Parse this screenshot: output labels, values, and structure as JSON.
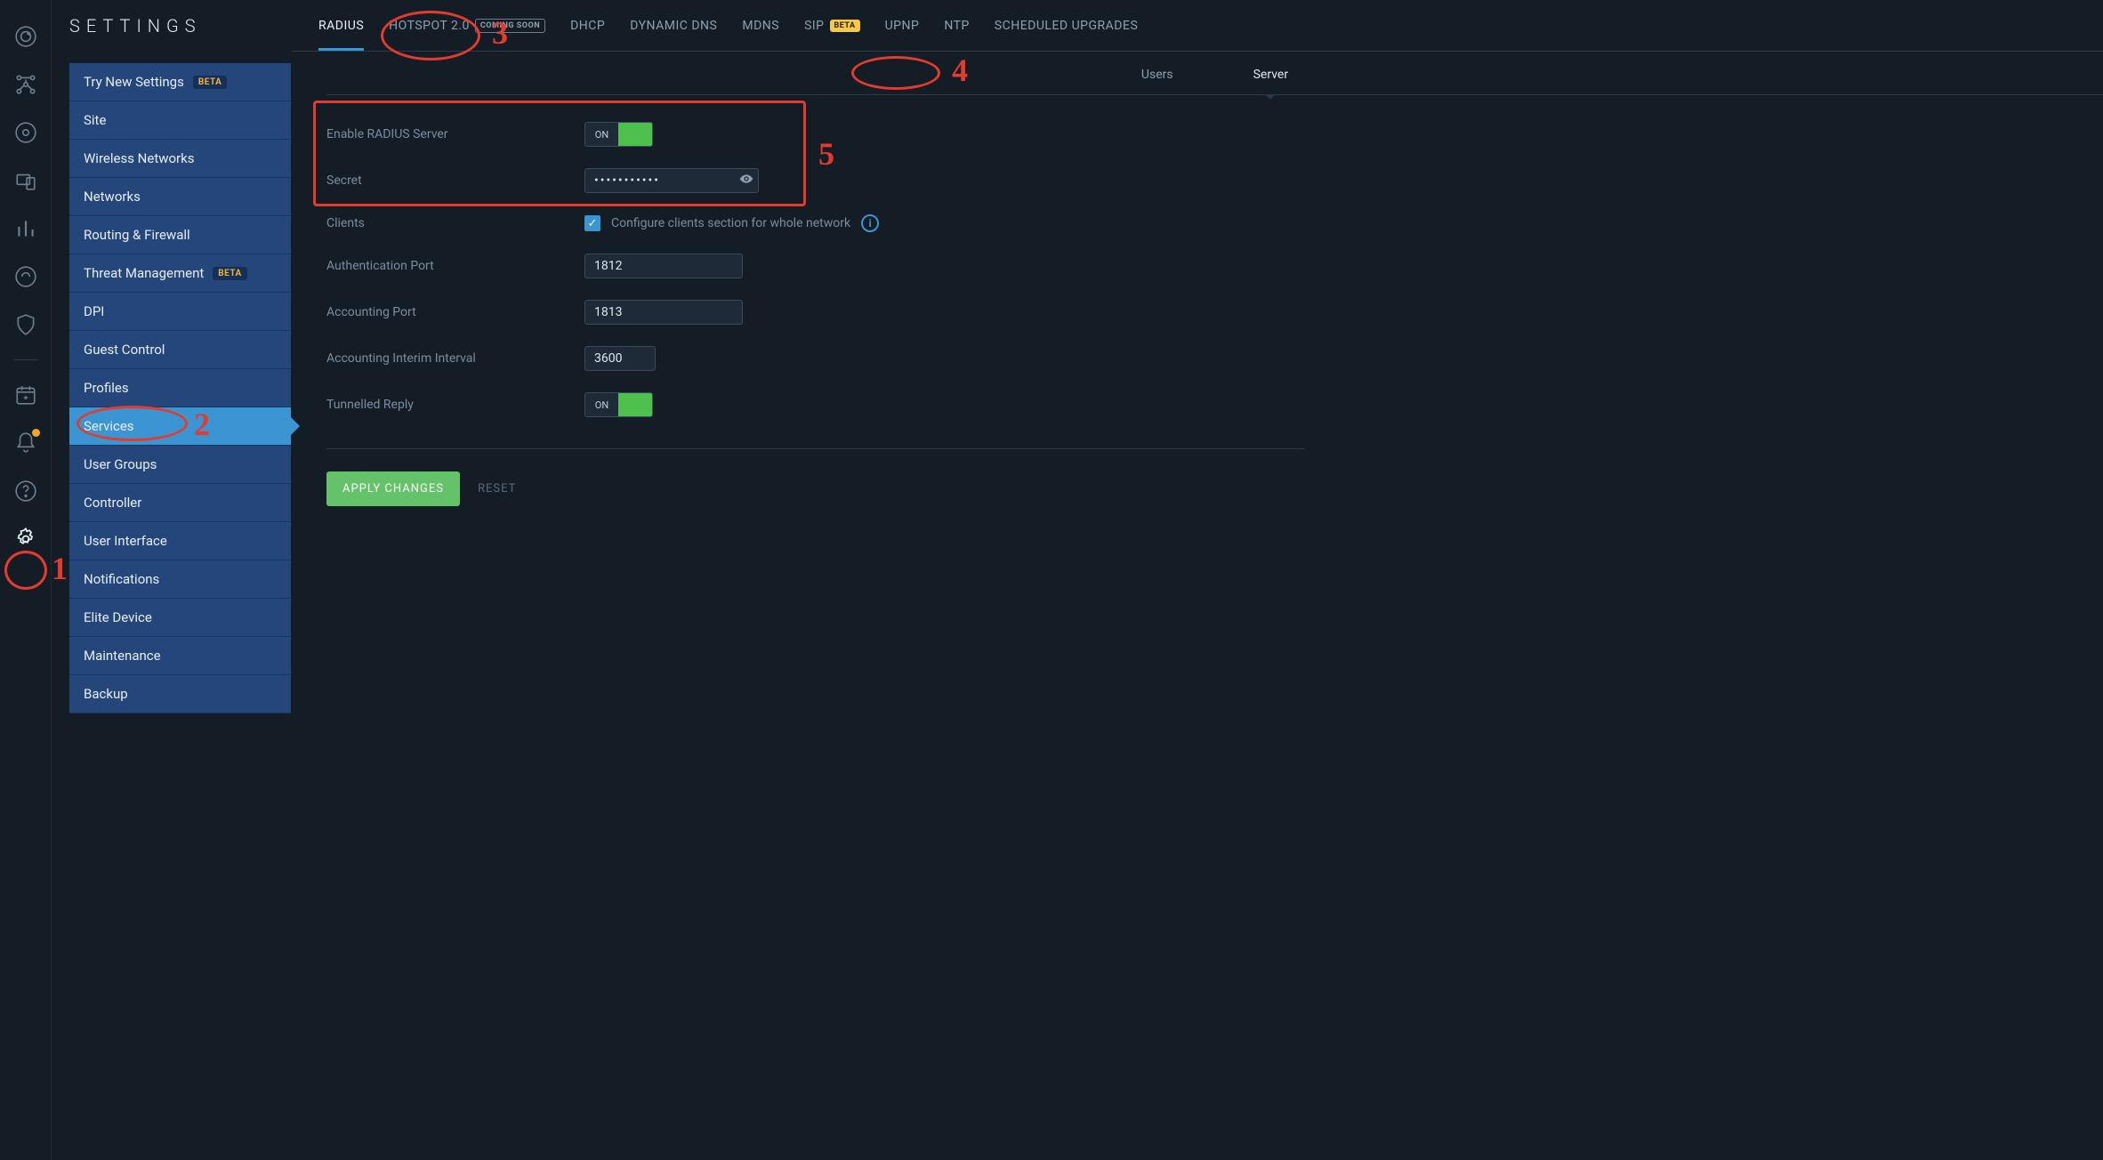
{
  "page_title": "SETTINGS",
  "top_tabs": {
    "radius": "RADIUS",
    "hotspot": "HOTSPOT 2.0",
    "hotspot_badge": "COMING SOON",
    "dhcp": "DHCP",
    "dyndns": "DYNAMIC DNS",
    "mdns": "MDNS",
    "sip": "SIP",
    "sip_badge": "BETA",
    "upnp": "UPNP",
    "ntp": "NTP",
    "sched": "SCHEDULED UPGRADES"
  },
  "subtabs": {
    "users": "Users",
    "server": "Server"
  },
  "sidebar": {
    "try_new": "Try New Settings",
    "try_new_badge": "BETA",
    "site": "Site",
    "wireless": "Wireless Networks",
    "networks": "Networks",
    "routing": "Routing & Firewall",
    "threat": "Threat Management",
    "threat_badge": "BETA",
    "dpi": "DPI",
    "guest": "Guest Control",
    "profiles": "Profiles",
    "services": "Services",
    "user_groups": "User Groups",
    "controller": "Controller",
    "ui": "User Interface",
    "notifications": "Notifications",
    "elite": "Elite Device",
    "maintenance": "Maintenance",
    "backup": "Backup"
  },
  "form": {
    "enable_label": "Enable RADIUS Server",
    "enable_state": "ON",
    "secret_label": "Secret",
    "secret_value": "•••••••••••",
    "clients_label": "Clients",
    "clients_desc": "Configure clients section for whole network",
    "auth_port_label": "Authentication Port",
    "auth_port_value": "1812",
    "acct_port_label": "Accounting Port",
    "acct_port_value": "1813",
    "interval_label": "Accounting Interim Interval",
    "interval_value": "3600",
    "tunnelled_label": "Tunnelled Reply",
    "tunnelled_state": "ON"
  },
  "buttons": {
    "apply": "APPLY CHANGES",
    "reset": "RESET"
  },
  "annotations": {
    "n1": "1",
    "n2": "2",
    "n3": "3",
    "n4": "4",
    "n5": "5"
  }
}
